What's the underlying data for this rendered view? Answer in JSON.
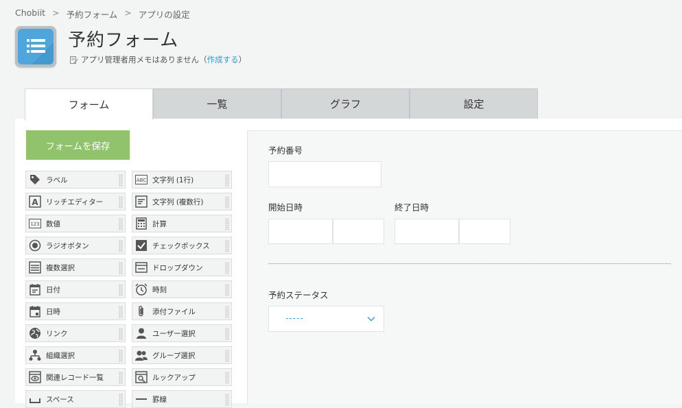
{
  "breadcrumb": [
    "Chobiit",
    "予約フォーム",
    "アプリの設定"
  ],
  "breadcrumb_sep": ">",
  "app": {
    "title": "予約フォーム",
    "memo_text": "アプリ管理者用メモはありません（",
    "memo_link": "作成する",
    "memo_end": "）"
  },
  "tabs": [
    "フォーム",
    "一覧",
    "グラフ",
    "設定"
  ],
  "save_label": "フォームを保存",
  "palette": [
    {
      "label": "ラベル",
      "icon": "tag-icon"
    },
    {
      "label": "文字列 (1行)",
      "icon": "abc-icon"
    },
    {
      "label": "リッチエディター",
      "icon": "rich-text-icon"
    },
    {
      "label": "文字列 (複数行)",
      "icon": "multiline-text-icon"
    },
    {
      "label": "数値",
      "icon": "number-icon"
    },
    {
      "label": "計算",
      "icon": "calculator-icon"
    },
    {
      "label": "ラジオボタン",
      "icon": "radio-icon"
    },
    {
      "label": "チェックボックス",
      "icon": "checkbox-icon"
    },
    {
      "label": "複数選択",
      "icon": "multi-select-icon"
    },
    {
      "label": "ドロップダウン",
      "icon": "dropdown-icon"
    },
    {
      "label": "日付",
      "icon": "date-icon"
    },
    {
      "label": "時刻",
      "icon": "clock-icon"
    },
    {
      "label": "日時",
      "icon": "datetime-icon"
    },
    {
      "label": "添付ファイル",
      "icon": "paperclip-icon"
    },
    {
      "label": "リンク",
      "icon": "globe-icon"
    },
    {
      "label": "ユーザー選択",
      "icon": "user-icon"
    },
    {
      "label": "組織選択",
      "icon": "org-icon"
    },
    {
      "label": "グループ選択",
      "icon": "group-icon"
    },
    {
      "label": "関連レコード一覧",
      "icon": "related-records-icon"
    },
    {
      "label": "ルックアップ",
      "icon": "lookup-icon"
    },
    {
      "label": "スペース",
      "icon": "space-icon"
    },
    {
      "label": "罫線",
      "icon": "line-icon"
    }
  ],
  "form": {
    "reservation_number": "予約番号",
    "start_datetime": "開始日時",
    "end_datetime": "終了日時",
    "status_label": "予約ステータス",
    "status_value": "-----"
  },
  "colors": {
    "accent": "#3498db",
    "save": "#91c36c",
    "app_icon": "#4ea6dd"
  }
}
